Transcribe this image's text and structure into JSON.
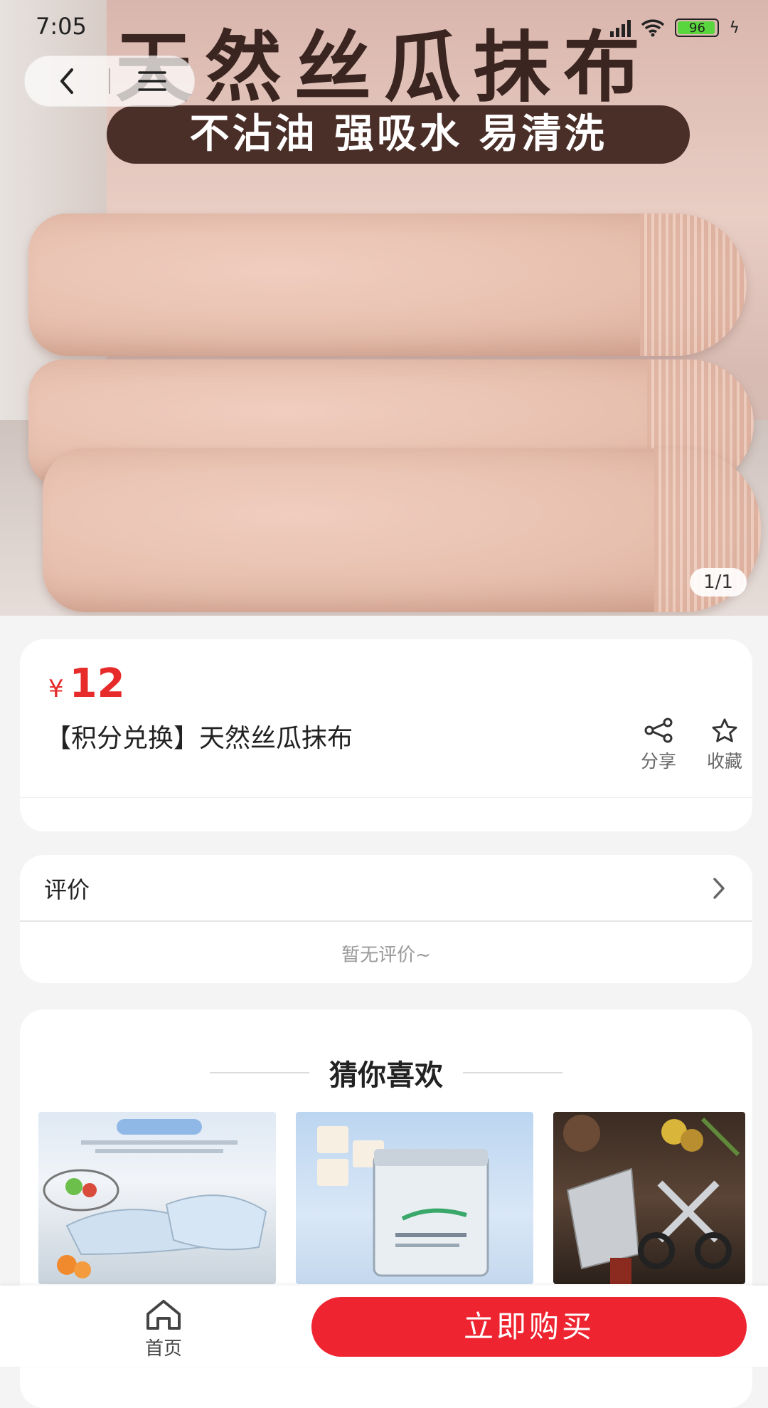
{
  "status_bar": {
    "time": "7:05",
    "battery": "96"
  },
  "hero": {
    "title": "天然丝瓜抹布",
    "banner": "不沾油 强吸水 易清洗",
    "pagination": "1/1"
  },
  "product": {
    "currency": "¥",
    "price": "12",
    "title": "【积分兑换】天然丝瓜抹布",
    "share_label": "分享",
    "favorite_label": "收藏"
  },
  "reviews": {
    "heading": "评价",
    "empty_text": "暂无评价~"
  },
  "recommendations": {
    "heading": "猜你喜欢",
    "items": [
      {
        "image": "rubber-gloves-product"
      },
      {
        "image": "pavina-cleansing-cream-product"
      },
      {
        "image": "kitchen-knife-scissors-product"
      }
    ]
  },
  "bottom_bar": {
    "home_label": "首页",
    "buy_label": "立即购买"
  },
  "colors": {
    "accent_red": "#ee2531",
    "price_red": "#e72a2a"
  }
}
